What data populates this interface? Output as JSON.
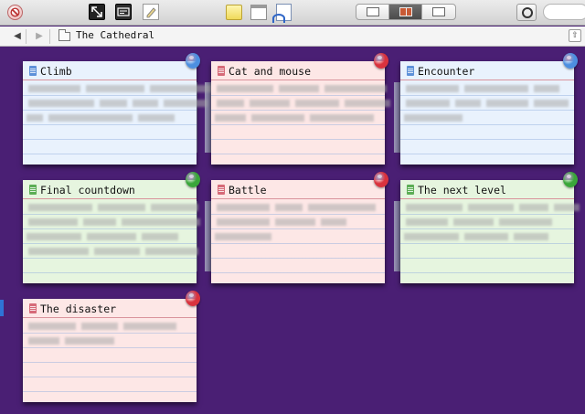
{
  "window": {
    "location_title": "The Cathedral"
  },
  "icons": {
    "stop": "stop-icon",
    "fullscreen": "fullscreen-icon",
    "compose": "compose-mode-icon",
    "edit": "edit-icon",
    "notes": "note-icon",
    "window": "window-icon",
    "doc": "document-icon",
    "inspector": "inspector-icon"
  },
  "cards": [
    {
      "title": "Climb",
      "bg": "#e9f2fd",
      "pin": "#4d8fe0",
      "doc": "#5e91d9",
      "lines": [
        [
          6,
          57,
          64,
          68,
          10
        ],
        [
          6,
          72,
          30,
          28,
          48,
          56
        ],
        [
          4,
          18,
          92,
          40
        ]
      ]
    },
    {
      "title": "Cat and mouse",
      "bg": "#fde7e6",
      "pin": "#d9333e",
      "doc": "#d66a78",
      "lines": [
        [
          6,
          62,
          44,
          68
        ],
        [
          6,
          30,
          44,
          48,
          50
        ],
        [
          4,
          34,
          58,
          70
        ]
      ]
    },
    {
      "title": "Encounter",
      "bg": "#e9f2fd",
      "pin": "#4d8fe0",
      "doc": "#5e91d9",
      "lines": [
        [
          6,
          58,
          70,
          28
        ],
        [
          6,
          48,
          28,
          46,
          38
        ],
        [
          4,
          64
        ]
      ]
    },
    {
      "title": "Final countdown",
      "bg": "#e6f5df",
      "pin": "#3aa63a",
      "doc": "#5cad55",
      "lines": [
        [
          6,
          70,
          52,
          52
        ],
        [
          6,
          54,
          36,
          86
        ],
        [
          4,
          60,
          54,
          40
        ],
        [
          6,
          66,
          50,
          58
        ]
      ]
    },
    {
      "title": "Battle",
      "bg": "#fde7e6",
      "pin": "#d9333e",
      "doc": "#d66a78",
      "lines": [
        [
          6,
          58,
          30,
          74
        ],
        [
          6,
          58,
          44,
          28
        ],
        [
          4,
          62
        ]
      ]
    },
    {
      "title": "The next level",
      "bg": "#e6f5df",
      "pin": "#3aa63a",
      "doc": "#5cad55",
      "lines": [
        [
          6,
          62,
          50,
          32,
          28
        ],
        [
          6,
          46,
          44,
          58
        ],
        [
          4,
          60,
          48,
          38
        ]
      ]
    },
    {
      "title": "The disaster",
      "bg": "#fde7e6",
      "pin": "#d9333e",
      "doc": "#d66a78",
      "lines": [
        [
          6,
          52,
          40,
          58
        ],
        [
          6,
          34,
          54
        ],
        [
          4
        ]
      ]
    }
  ]
}
